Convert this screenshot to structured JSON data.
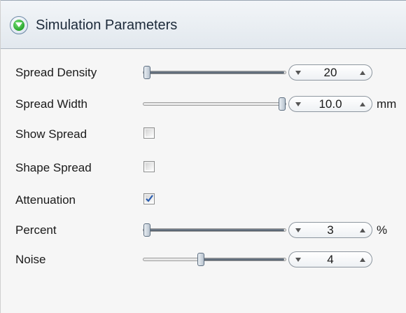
{
  "panel": {
    "title": "Simulation Parameters",
    "collapse_icon": "chevron-down-icon"
  },
  "sliders": [
    {
      "id": "spread-density",
      "label": "Spread Density",
      "value": "20",
      "level": 0.0,
      "unit": ""
    },
    {
      "id": "spread-width",
      "label": "Spread Width",
      "value": "10.0",
      "level": 1.0,
      "unit": "mm"
    },
    {
      "id": "percent",
      "label": "Percent",
      "value": "3",
      "level": 0.0,
      "unit": "%"
    },
    {
      "id": "noise",
      "label": "Noise",
      "value": "4",
      "level": 0.4,
      "unit": ""
    }
  ],
  "checkboxes": [
    {
      "id": "show-spread",
      "label": "Show Spread",
      "checked": false
    },
    {
      "id": "shape-spread",
      "label": "Shape Spread",
      "checked": false
    },
    {
      "id": "attenuation",
      "label": "Attenuation",
      "checked": true
    }
  ],
  "colors": {
    "header_bg": "#e2e8ee",
    "collapse_green": "#27a52b",
    "check_blue": "#2a5db0"
  }
}
